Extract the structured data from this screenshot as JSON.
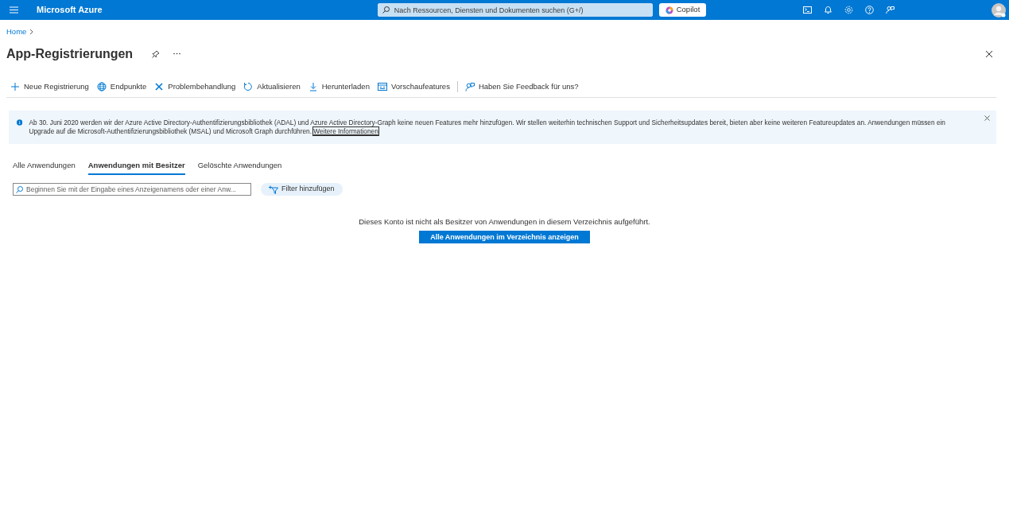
{
  "topbar": {
    "brand": "Microsoft Azure",
    "search_placeholder": "Nach Ressourcen, Diensten und Dokumenten suchen (G+/)",
    "copilot": "Copilot"
  },
  "breadcrumb": [
    {
      "label": "Home"
    }
  ],
  "page_title": "App-Registrierungen",
  "toolbar": [
    {
      "label": "Neue Registrierung"
    },
    {
      "label": "Endpunkte"
    },
    {
      "label": "Problembehandlung"
    },
    {
      "label": "Aktualisieren"
    },
    {
      "label": "Herunterladen"
    },
    {
      "label": "Vorschaufeatures"
    },
    {
      "label": "Haben Sie Feedback für uns?"
    }
  ],
  "banner": {
    "text": "Ab 30. Juni 2020 werden wir der Azure Active Directory-Authentifizierungsbibliothek (ADAL) und Azure Active Directory-Graph keine neuen Features mehr hinzufügen. Wir stellen weiterhin technischen Support und Sicherheitsupdates bereit, bieten aber keine weiteren Featureupdates an. Anwendungen müssen ein Upgrade auf die Microsoft-Authentifizierungsbibliothek (MSAL) und Microsoft Graph durchführen.",
    "link": "Weitere Informationen"
  },
  "tabs": [
    {
      "label": "Alle Anwendungen",
      "selected": false
    },
    {
      "label": "Anwendungen mit Besitzer",
      "selected": true
    },
    {
      "label": "Gelöschte Anwendungen",
      "selected": false
    }
  ],
  "filter": {
    "placeholder": "Beginnen Sie mit der Eingabe eines Anzeigenamens oder einer Anw...",
    "button": "Filter hinzufügen"
  },
  "empty_state": {
    "message": "Dieses Konto ist nicht als Besitzer von Anwendungen in diesem Verzeichnis aufgeführt.",
    "button": "Alle Anwendungen im Verzeichnis anzeigen"
  }
}
